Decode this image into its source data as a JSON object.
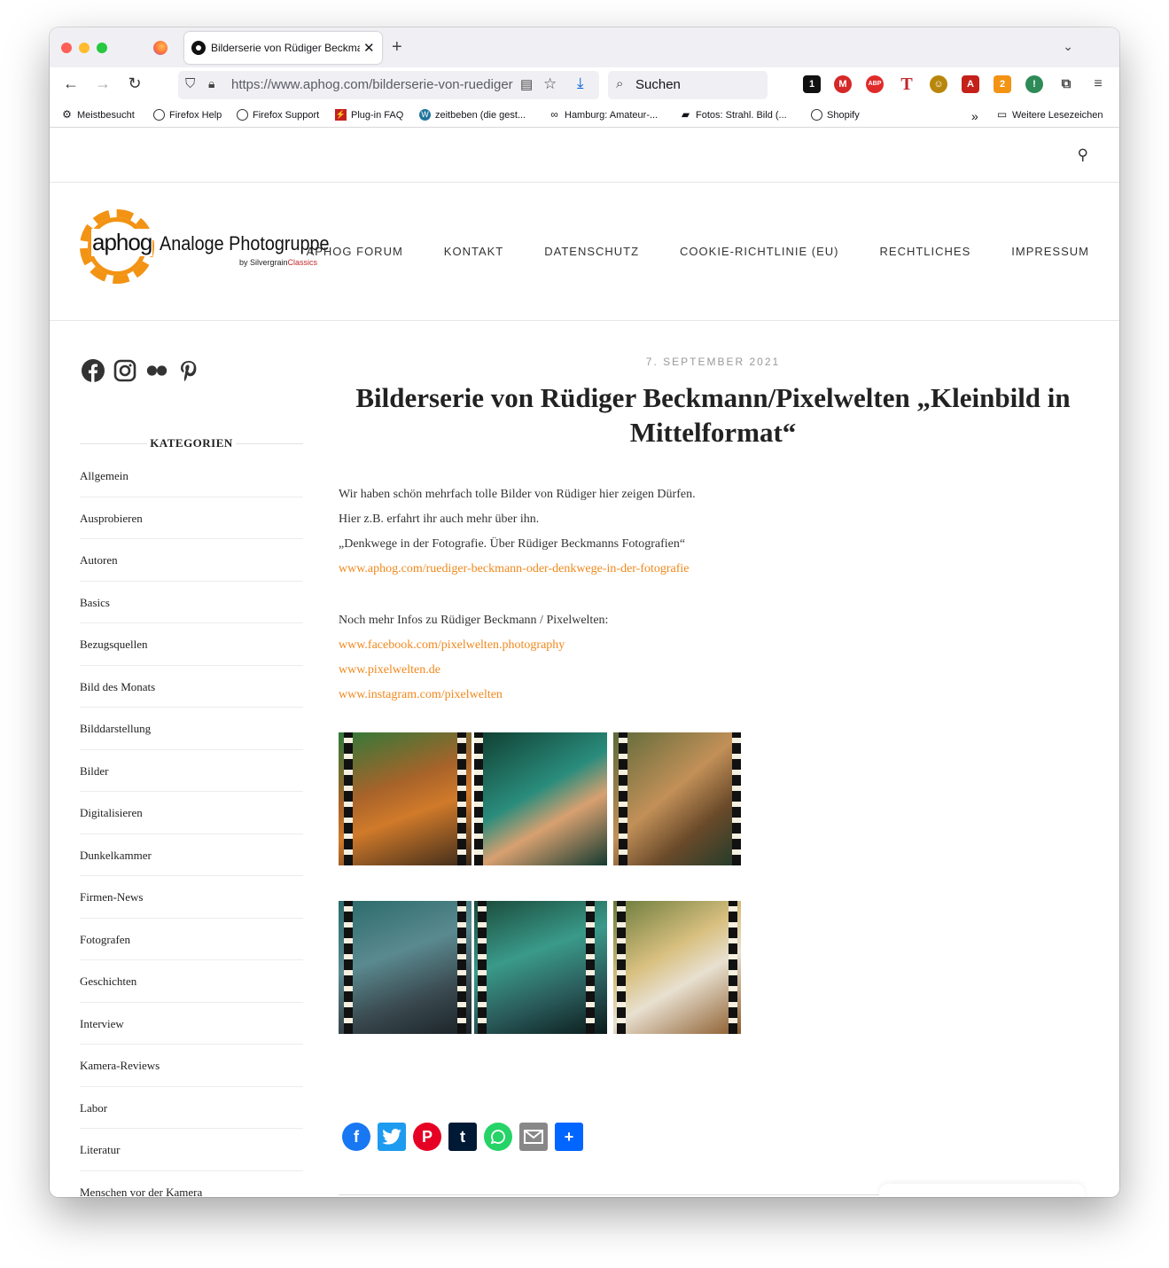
{
  "browser": {
    "tab_title": "Bilderserie von Rüdiger Beckmann/Pixelwelten „Kleinbild in Mittelformat“",
    "tab_close": "✕",
    "new_tab": "+",
    "tab_list": "⌄",
    "url": "https://www.aphog.com/bilderserie-von-ruediger-beckmann-pixelwelten",
    "search_placeholder": "Suchen",
    "back": "←",
    "forward": "→",
    "reload": "↻"
  },
  "bookmarks": [
    {
      "label": "Meistbesucht",
      "icon": "gear-icon"
    },
    {
      "label": "Firefox Help",
      "icon": "globe-icon"
    },
    {
      "label": "Firefox Support",
      "icon": "globe-icon"
    },
    {
      "label": "Plug-in FAQ",
      "icon": "plugin-icon"
    },
    {
      "label": "zeitbeben (die gest...",
      "icon": "wordpress-icon"
    },
    {
      "label": "Hamburg: Amateur-...",
      "icon": "link-icon"
    },
    {
      "label": "Fotos: Strahl. Bild (...",
      "icon": "photo-icon"
    },
    {
      "label": "Shopify",
      "icon": "globe-icon"
    },
    {
      "label": "Weitere Lesezeichen",
      "icon": "folder-icon"
    }
  ],
  "site": {
    "logo_word": "aphog",
    "logo_name": "Analoge Photogruppe",
    "logo_sub_prefix": "by Silvergrain",
    "logo_sub_brand": "Classics",
    "nav": [
      "APHOG FORUM",
      "KONTAKT",
      "DATENSCHUTZ",
      "COOKIE-RICHTLINIE (EU)",
      "RECHTLICHES",
      "IMPRESSUM"
    ]
  },
  "sidebar": {
    "categories_title": "KATEGORIEN",
    "categories": [
      "Allgemein",
      "Ausprobieren",
      "Autoren",
      "Basics",
      "Bezugsquellen",
      "Bild des Monats",
      "Bilddarstellung",
      "Bilder",
      "Digitalisieren",
      "Dunkelkammer",
      "Firmen-News",
      "Fotografen",
      "Geschichten",
      "Interview",
      "Kamera-Reviews",
      "Labor",
      "Literatur",
      "Menschen vor der Kamera"
    ]
  },
  "article": {
    "date": "7. SEPTEMBER 2021",
    "title": "Bilderserie von Rüdiger Beckmann/Pixelwelten „Kleinbild in Mittelformat“",
    "p1": "Wir haben schön mehrfach tolle Bilder von Rüdiger hier zeigen Dürfen.",
    "p2": "Hier z.B. erfahrt ihr auch mehr über ihn.",
    "p3": "„Denkwege in der Fotografie. Über Rüdiger Beckmanns Fotografien“",
    "link1": "www.aphog.com/ruediger-beckmann-oder-denkwege-in-der-fotografie",
    "p4": "Noch  mehr Infos zu Rüdiger Beckmann / Pixelwelten:",
    "link2": "www.facebook.com/pixelwelten.photography",
    "link3": "www.pixelwelten.de",
    "link4": "www.instagram.com/pixelwelten"
  },
  "colors": {
    "accent": "#f0881c",
    "logo_orange": "#f39314"
  }
}
